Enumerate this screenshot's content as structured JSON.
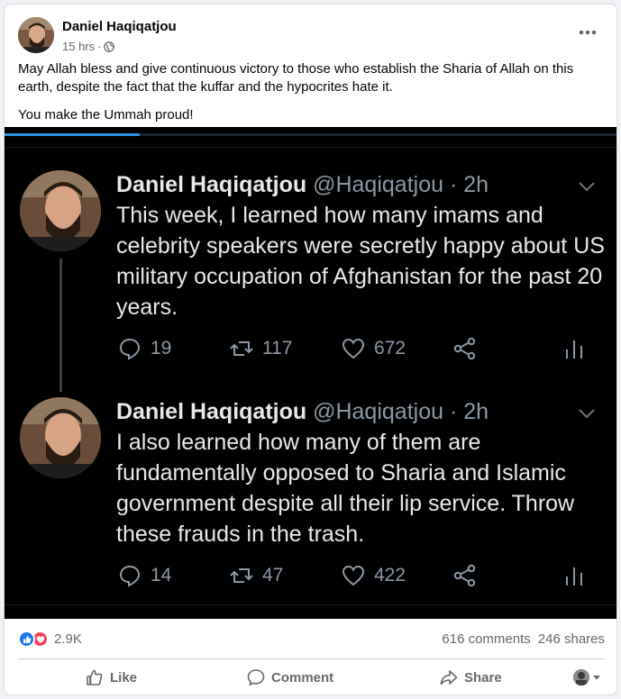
{
  "post": {
    "author": "Daniel Haqiqatjou",
    "time": "15 hrs",
    "separator": "·",
    "more_icon": "more-horiz-icon",
    "paragraphs": [
      "May Allah bless and give continuous victory to those who establish the Sharia of Allah on this earth, despite the fact that the kuffar and the hypocrites hate it.",
      "You make the Ummah proud!"
    ]
  },
  "screenshot": {
    "progress": 0.22,
    "tweets": [
      {
        "name": "Daniel Haqiqatjou",
        "handle": "@Haqiqatjou",
        "age": "· 2h",
        "text": "This week, I learned how many imams and celebrity speakers were secretly happy about US military occupation of Afghanistan for the past 20 years.",
        "replies": "19",
        "retweets": "117",
        "likes": "672"
      },
      {
        "name": "Daniel Haqiqatjou",
        "handle": "@Haqiqatjou",
        "age": "· 2h",
        "text": "I also learned how many of them are fundamentally opposed to Sharia and Islamic government despite all their lip service. Throw these frauds in the trash.",
        "replies": "14",
        "retweets": "47",
        "likes": "422"
      }
    ]
  },
  "stats": {
    "reactions": "2.9K",
    "comments": "616 comments",
    "shares": "246 shares"
  },
  "actions": {
    "like": "Like",
    "comment": "Comment",
    "share": "Share"
  },
  "colors": {
    "fb_blue": "#1877f2",
    "love_red": "#f33e58",
    "twitter_progress": "#2a8fe0",
    "tweet_bg": "#000000"
  }
}
